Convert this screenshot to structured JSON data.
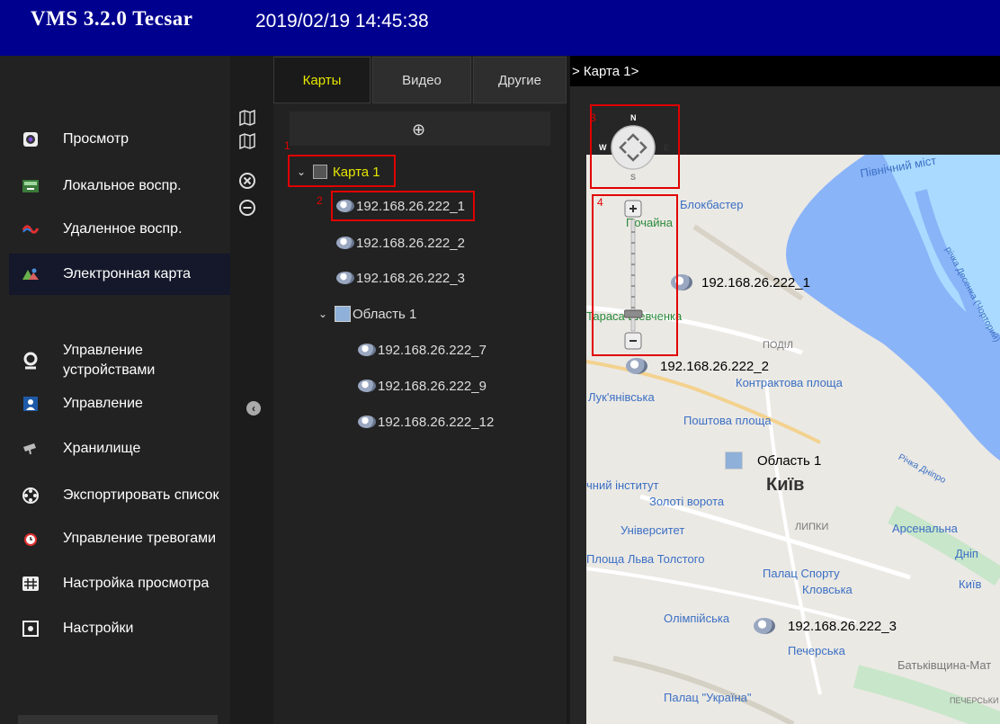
{
  "header": {
    "app_title": "VMS 3.2.0 Tecsar",
    "datetime": "2019/02/19 14:45:38"
  },
  "sidebar": {
    "items": [
      {
        "label": "Просмотр",
        "icon": "camera-lens-icon"
      },
      {
        "label": "Локальное воспр.",
        "icon": "local-playback-icon"
      },
      {
        "label": "Удаленное воспр.",
        "icon": "remote-playback-icon"
      },
      {
        "label": "Электронная карта",
        "icon": "emap-icon"
      },
      {
        "label": "Управление устройствами",
        "icon": "webcam-icon"
      },
      {
        "label": "Управление",
        "icon": "user-icon"
      },
      {
        "label": "Хранилище",
        "icon": "cctv-camera-icon"
      },
      {
        "label": "Экспортировать список",
        "icon": "film-reel-icon"
      },
      {
        "label": "Управление тревогами",
        "icon": "alarm-clock-icon"
      },
      {
        "label": "Настройка просмотра",
        "icon": "grid-icon"
      },
      {
        "label": "Настройки",
        "icon": "settings-icon"
      }
    ]
  },
  "tabs": [
    "Карты",
    "Видео",
    "Другие"
  ],
  "tree": {
    "map": "Карта 1",
    "cameras": [
      "192.168.26.222_1",
      "192.168.26.222_2",
      "192.168.26.222_3"
    ],
    "area": "Область 1",
    "area_cameras": [
      "192.168.26.222_7",
      "192.168.26.222_9",
      "192.168.26.222_12"
    ]
  },
  "breadcrumb": "> Карта 1>",
  "annotations": [
    "1",
    "2",
    "3",
    "4"
  ],
  "compass": {
    "n": "N",
    "w": "W",
    "e": "E",
    "s": "S"
  },
  "map": {
    "markers": [
      "192.168.26.222_1",
      "192.168.26.222_2",
      "192.168.26.222_3",
      "Область 1"
    ],
    "labels": {
      "pivnichnyi": "Північний міст",
      "blockbuster": "Блокбастер",
      "pochaina": "Почайна",
      "tarasa": "Тараса Шевченка",
      "podil": "ПОДІЛ",
      "kontraktova": "Контрактова площа",
      "lukianivska": "Лук'янівська",
      "poshtova": "Поштова площа",
      "institut": "чний інститут",
      "kyiv": "Київ",
      "zoloti": "Золоті ворота",
      "lypky": "ЛИПКИ",
      "arsenalna": "Арсенальна",
      "universytet": "Університет",
      "tolstoho": "Площа Льва Толстого",
      "palats_sportu": "Палац Спорту",
      "dnipro": "Дніп",
      "klovska": "Кловська",
      "kyive": "Київ",
      "olimpiiska": "Олімпійська",
      "pecherska": "Печерська",
      "batkivshchyna": "Батьківщина-Мат",
      "palats_ukraina": "Палац \"Україна\"",
      "pecherskyi": "ПЕЧЕРСЬКИ",
      "desenka": "річка Десенка (Чорторий)",
      "dnipro_river": "Річка Дніпро"
    }
  },
  "colors": {
    "header_bg": "#00008f",
    "tab_active": "#e6e600",
    "annotation": "#e00000"
  }
}
